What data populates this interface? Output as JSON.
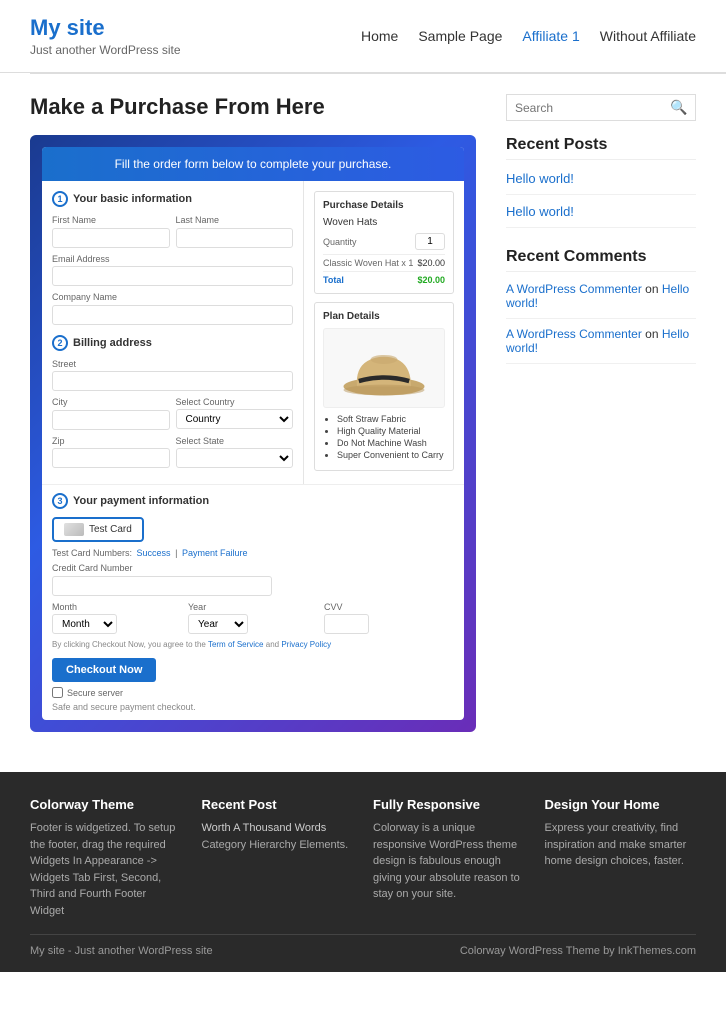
{
  "header": {
    "site_title": "My site",
    "tagline": "Just another WordPress site",
    "nav": [
      {
        "label": "Home",
        "active": false
      },
      {
        "label": "Sample Page",
        "active": false
      },
      {
        "label": "Affiliate 1",
        "active": true
      },
      {
        "label": "Without Affiliate",
        "active": false
      }
    ]
  },
  "main": {
    "page_title": "Make a Purchase From Here",
    "form": {
      "header_text": "Fill the order form below to complete your purchase.",
      "section1_label": "Your basic information",
      "section1_num": "1",
      "field_first_name": "First Name",
      "field_last_name": "Last Name",
      "field_email": "Email Address",
      "field_company": "Company Name",
      "section2_label": "Billing address",
      "section2_num": "2",
      "field_street": "Street",
      "field_city": "City",
      "field_country_label": "Select Country",
      "field_country_placeholder": "Country",
      "field_zip": "Zip",
      "field_state_label": "Select State",
      "section3_label": "Your payment information",
      "section3_num": "3",
      "card_btn_label": "Test Card",
      "test_card_numbers": "Test Card Numbers:",
      "test_card_success": "Success",
      "test_card_separator": "|",
      "test_card_failure": "Payment Failure",
      "field_cc_label": "Credit Card Number",
      "field_month": "Month",
      "field_year": "Year",
      "field_cvv": "CVV",
      "terms_text": "By clicking Checkout Now, you agree to the",
      "terms_link1": "Term of Service",
      "terms_and": "and",
      "terms_link2": "Privacy Policy",
      "checkout_btn": "Checkout Now",
      "secure_label": "Secure server",
      "safe_text": "Safe and secure payment checkout."
    },
    "purchase": {
      "title": "Purchase Details",
      "product_name": "Woven Hats",
      "qty_label": "Quantity",
      "qty_value": "1",
      "line_item_label": "Classic Woven Hat x 1",
      "line_item_price": "$20.00",
      "total_label": "Total",
      "total_price": "$20.00"
    },
    "plan": {
      "title": "Plan Details",
      "features": [
        "Soft Straw Fabric",
        "High Quality Material",
        "Do Not Machine Wash",
        "Super Convenient to Carry"
      ]
    }
  },
  "sidebar": {
    "search_placeholder": "Search",
    "recent_posts_title": "Recent Posts",
    "posts": [
      {
        "label": "Hello world!"
      },
      {
        "label": "Hello world!"
      }
    ],
    "recent_comments_title": "Recent Comments",
    "comments": [
      {
        "author": "A WordPress Commenter",
        "text": "on",
        "post": "Hello world!"
      },
      {
        "author": "A WordPress Commenter",
        "text": "on",
        "post": "Hello world!"
      }
    ]
  },
  "footer": {
    "col1_title": "Colorway Theme",
    "col1_text": "Footer is widgetized. To setup the footer, drag the required Widgets In Appearance -> Widgets Tab First, Second, Third and Fourth Footer Widget",
    "col2_title": "Recent Post",
    "col2_link": "Worth A Thousand Words",
    "col2_text": "Category Hierarchy Elements.",
    "col3_title": "Fully Responsive",
    "col3_text": "Colorway is a unique responsive WordPress theme design is fabulous enough giving your absolute reason to stay on your site.",
    "col4_title": "Design Your Home",
    "col4_text": "Express your creativity, find inspiration and make smarter home design choices, faster.",
    "bottom_left": "My site - Just another WordPress site",
    "bottom_right": "Colorway WordPress Theme by InkThemes.com"
  }
}
